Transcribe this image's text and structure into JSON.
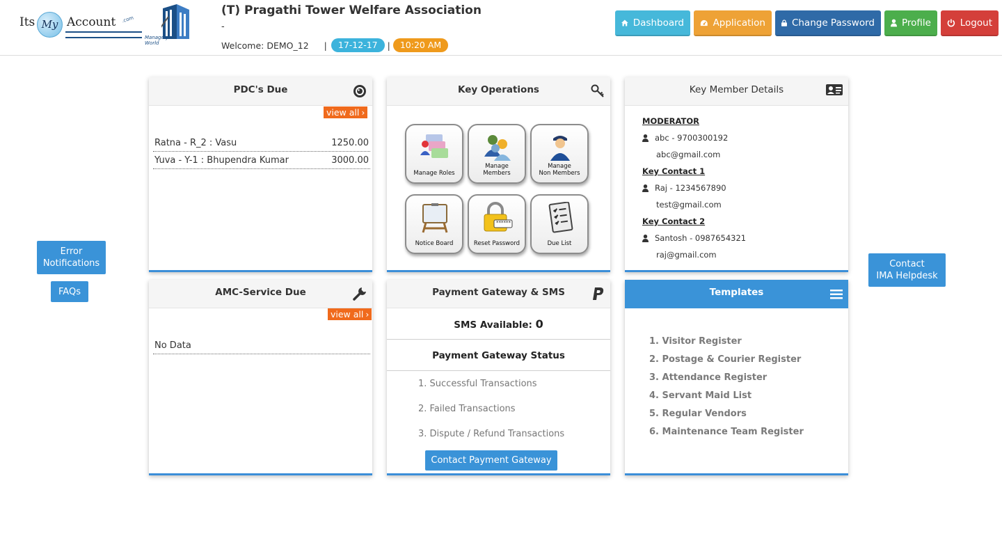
{
  "brand": {
    "logo_its": "Its",
    "logo_my": "My",
    "logo_account": "Account",
    "logo_com": ".com",
    "logo_tagline": "Manage your World"
  },
  "header": {
    "org_title": "(T) Pragathi Tower Welfare Association",
    "org_subtitle": "-",
    "welcome_label": "Welcome: DEMO_12",
    "separator": "|",
    "date": "17-12-17",
    "time": "10:20 AM"
  },
  "nav": {
    "dashboard": "Dashboard",
    "application": "Application",
    "change_password": "Change Password",
    "profile": "Profile",
    "logout": "Logout"
  },
  "side": {
    "error_notifications_line1": "Error",
    "error_notifications_line2": "Notifications",
    "faqs": "FAQs",
    "contact_line1": "Contact",
    "contact_line2": "IMA Helpdesk"
  },
  "pdc": {
    "title": "PDC's Due",
    "view_all": "view all",
    "rows": [
      {
        "name": "Ratna - R_2 : Vasu",
        "amount": "1250.00"
      },
      {
        "name": "Yuva - Y-1 : Bhupendra Kumar",
        "amount": "3000.00"
      }
    ]
  },
  "key_operations": {
    "title": "Key Operations",
    "tiles": [
      {
        "line1": "Manage Roles",
        "line2": ""
      },
      {
        "line1": "Manage",
        "line2": "Members"
      },
      {
        "line1": "Manage",
        "line2": "Non Members"
      },
      {
        "line1": "Notice Board",
        "line2": ""
      },
      {
        "line1": "Reset Password",
        "line2": ""
      },
      {
        "line1": "Due List",
        "line2": ""
      }
    ],
    "password_mask": "******"
  },
  "key_members": {
    "title": "Key Member Details",
    "moderator_label": "MODERATOR",
    "moderator_name": "abc - 9700300192",
    "moderator_email": "abc@gmail.com",
    "contact1_label": "Key Contact 1",
    "contact1_name": "Raj - 1234567890",
    "contact1_email": "test@gmail.com",
    "contact2_label": "Key Contact 2",
    "contact2_name": "Santosh - 0987654321",
    "contact2_email": "raj@gmail.com"
  },
  "amc": {
    "title": "AMC-Service Due",
    "view_all": "view all",
    "empty": "No Data"
  },
  "payment": {
    "title": "Payment Gateway & SMS",
    "sms_label": "SMS Available: ",
    "sms_count": "0",
    "status_title": "Payment Gateway Status",
    "items": [
      "1. Successful Transactions",
      "2. Failed Transactions",
      "3. Dispute / Refund Transactions"
    ],
    "contact_button": "Contact Payment Gateway"
  },
  "templates": {
    "title": "Templates",
    "items": [
      "1. Visitor Register",
      "2. Postage & Courier Register",
      "3. Attendance Register",
      "4. Servant Maid List",
      "5. Regular Vendors",
      "6. Maintenance Team Register"
    ]
  },
  "colors": {
    "accent_blue": "#3a93d8",
    "orange": "#f06a1c",
    "dashboard": "#46b8da",
    "application": "#eea236",
    "change_password": "#2f6aa7",
    "profile": "#4cae4c",
    "logout": "#d43f3a"
  }
}
